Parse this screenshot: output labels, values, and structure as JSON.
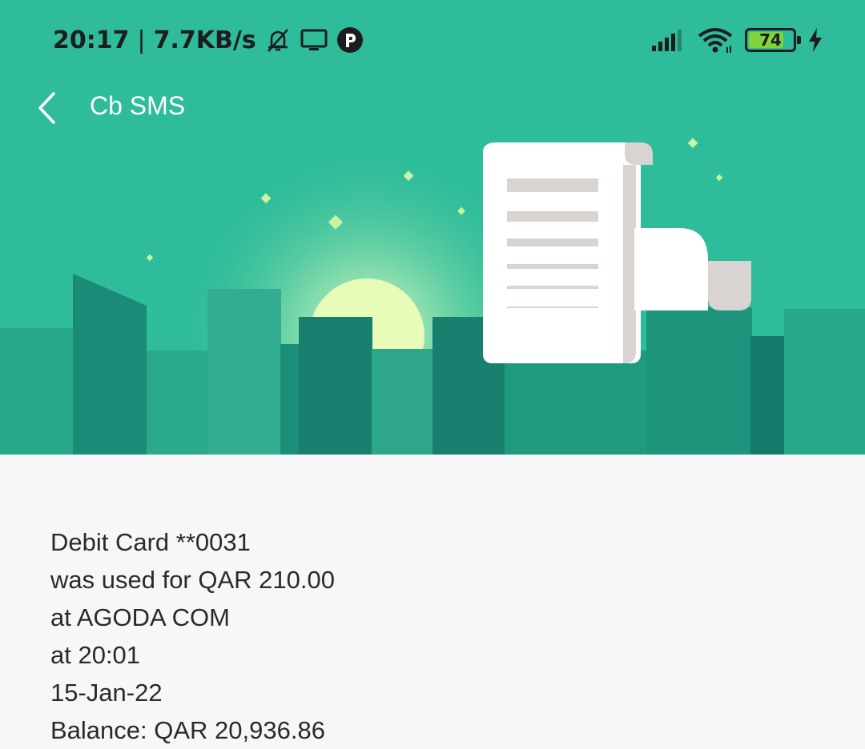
{
  "status_bar": {
    "time": "20:17",
    "separator": "|",
    "network_speed": "7.7KB/s",
    "icons_left": [
      "mute-icon",
      "screen-cast-icon",
      "app-notification-icon"
    ],
    "icons_right": [
      "cell-signal-icon",
      "wifi-icon",
      "battery-icon",
      "charging-icon"
    ],
    "battery_level": "74",
    "battery_fraction": 0.74
  },
  "appbar": {
    "title": "Cb SMS",
    "back_icon": "chevron-left-icon"
  },
  "colors": {
    "header_bg": "#2ebc9a",
    "page_bg": "#f7f7f7",
    "battery_fill": "#7fd33b"
  },
  "message": {
    "lines": [
      "Debit Card **0031",
      "was used for QAR 210.00",
      "at AGODA COM",
      "at 20:01",
      "15-Jan-22",
      "Balance: QAR 20,936.86"
    ]
  }
}
